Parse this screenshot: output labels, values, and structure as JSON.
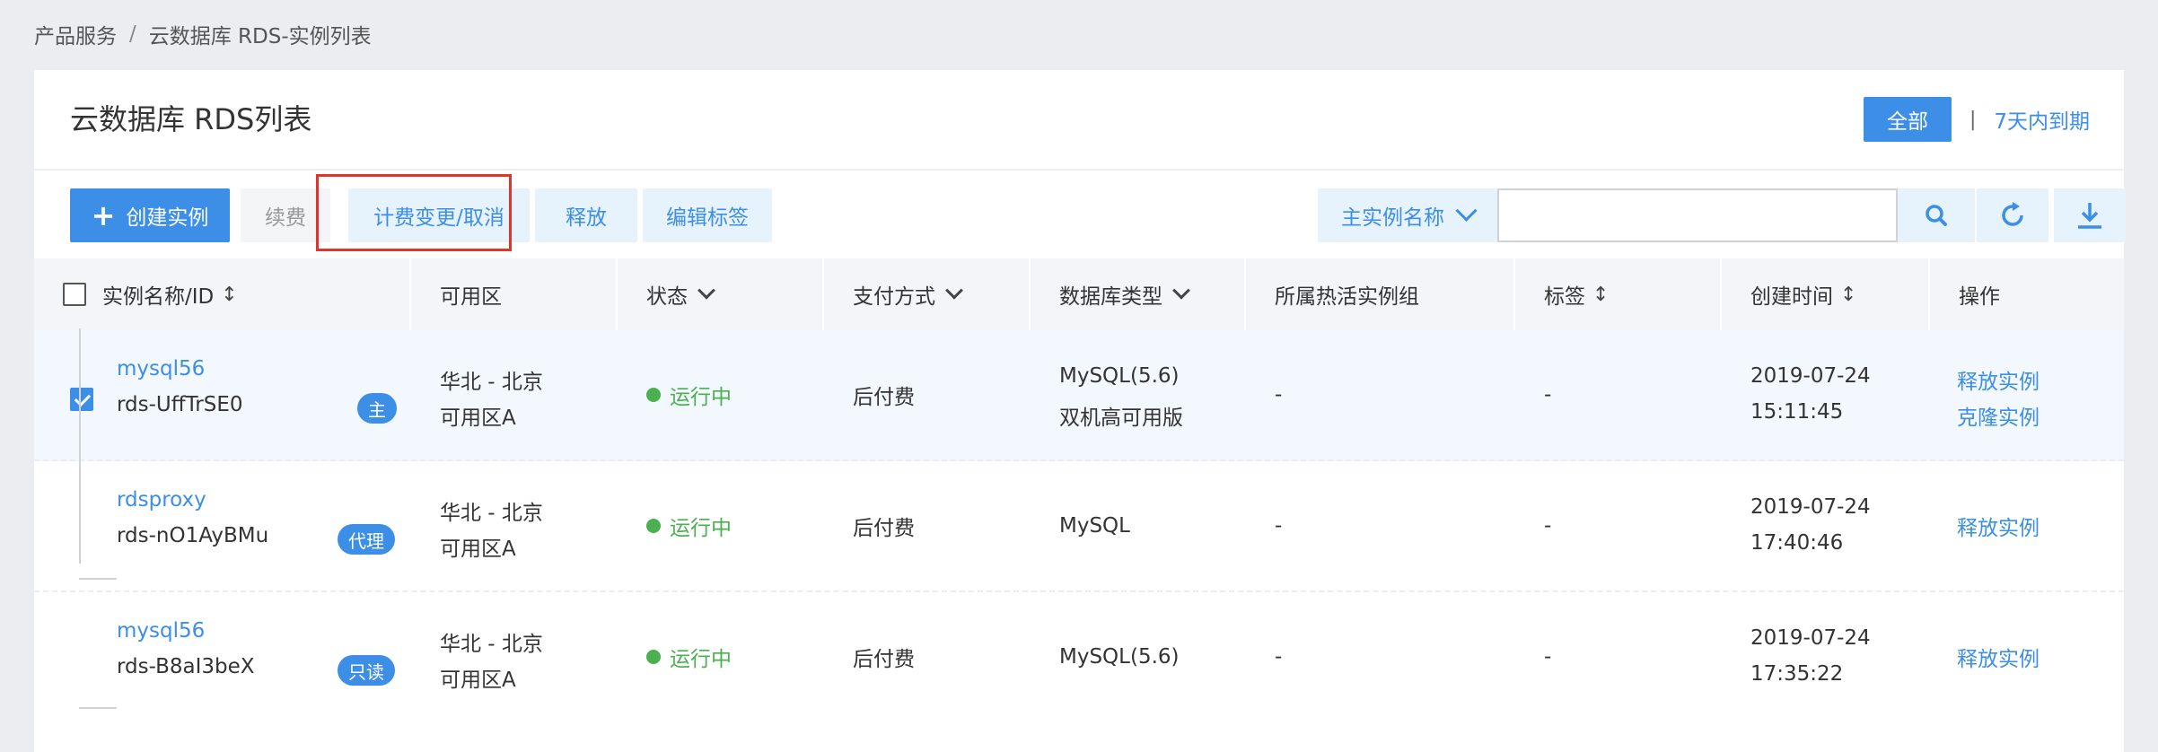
{
  "breadcrumb": {
    "root": "产品服务",
    "sep": "/",
    "current": "云数据库 RDS-实例列表"
  },
  "panel": {
    "title": "云数据库 RDS列表"
  },
  "filter": {
    "all_label": "全部",
    "divider": "|",
    "expire_label": "7天内到期"
  },
  "toolbar": {
    "create_label": "创建实例",
    "renew_label": "续费",
    "billing_label": "计费变更/取消",
    "release_label": "释放",
    "tags_label": "编辑标签",
    "search_select": "主实例名称",
    "search_value": ""
  },
  "table": {
    "headers": {
      "name": "实例名称/ID",
      "zone": "可用区",
      "status": "状态",
      "pay": "支付方式",
      "dbtype": "数据库类型",
      "hot": "所属热活实例组",
      "tag": "标签",
      "created": "创建时间",
      "ops": "操作"
    },
    "rows": [
      {
        "name": "mysql56",
        "id": "rds-UffTrSE0",
        "badge": "主",
        "zone1": "华北 - 北京",
        "zone2": "可用区A",
        "status": "运行中",
        "pay": "后付费",
        "db1": "MySQL(5.6)",
        "db2": "双机高可用版",
        "hot": "-",
        "tag": "-",
        "date": "2019-07-24",
        "time": "15:11:45",
        "op1": "释放实例",
        "op2": "克隆实例",
        "checked": true
      },
      {
        "name": "rdsproxy",
        "id": "rds-nO1AyBMu",
        "badge": "代理",
        "zone1": "华北 - 北京",
        "zone2": "可用区A",
        "status": "运行中",
        "pay": "后付费",
        "db1": "MySQL",
        "db2": "",
        "hot": "-",
        "tag": "-",
        "date": "2019-07-24",
        "time": "17:40:46",
        "op1": "释放实例",
        "op2": "",
        "checked": false
      },
      {
        "name": "mysql56",
        "id": "rds-B8aI3beX",
        "badge": "只读",
        "zone1": "华北 - 北京",
        "zone2": "可用区A",
        "status": "运行中",
        "pay": "后付费",
        "db1": "MySQL(5.6)",
        "db2": "",
        "hot": "-",
        "tag": "-",
        "date": "2019-07-24",
        "time": "17:35:22",
        "op1": "释放实例",
        "op2": "",
        "checked": false
      }
    ]
  },
  "colors": {
    "primary": "#3c8ee6",
    "running": "#4caf50",
    "highlight": "#e0352b"
  }
}
